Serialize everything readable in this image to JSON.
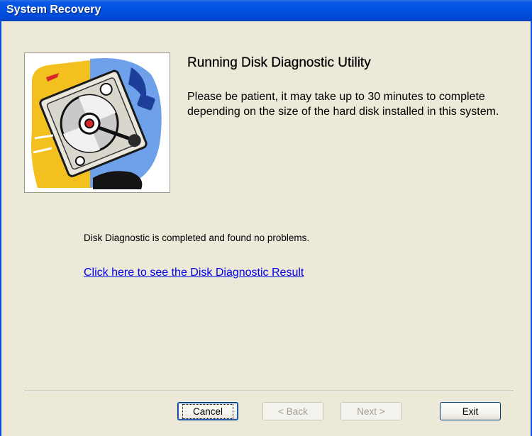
{
  "window": {
    "title": "System Recovery"
  },
  "content": {
    "heading": "Running Disk Diagnostic Utility",
    "description": "Please be patient, it may take up to 30 minutes to complete depending on the size of the hard disk installed in this system.",
    "status_message": "Disk Diagnostic is completed and found no problems.",
    "result_link": "Click here to see the Disk Diagnostic Result"
  },
  "buttons": {
    "cancel": "Cancel",
    "back": "< Back",
    "next": "Next >",
    "exit": "Exit"
  },
  "colors": {
    "titlebar": "#0054e3",
    "dialog_bg": "#ece9d8",
    "link": "#0000ee"
  },
  "icons": {
    "illustration": "hard-disk-illustration"
  }
}
